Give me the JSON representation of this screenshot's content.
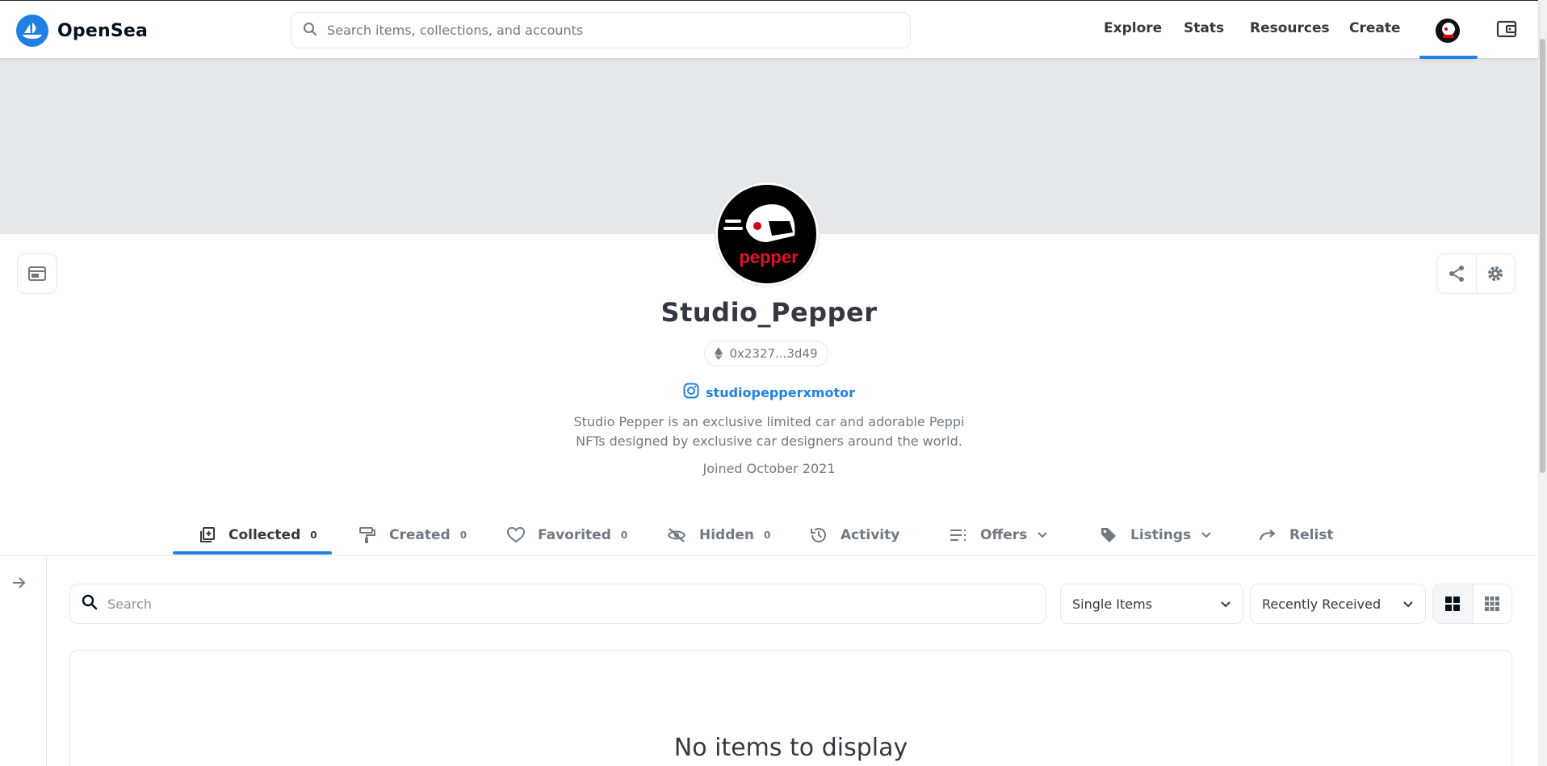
{
  "header": {
    "brand": "OpenSea",
    "search_placeholder": "Search items, collections, and accounts",
    "nav": [
      "Explore",
      "Stats",
      "Resources",
      "Create"
    ]
  },
  "profile": {
    "name": "Studio_Pepper",
    "address": "0x2327...3d49",
    "instagram": "studiopepperxmotor",
    "bio_line1": "Studio Pepper is an exclusive limited car and adorable Peppi",
    "bio_line2": "NFTs designed by exclusive car designers around the world.",
    "joined": "Joined October 2021",
    "avatar_text": "pepper"
  },
  "tabs": [
    {
      "label": "Collected",
      "count": "0",
      "icon": "collected-icon"
    },
    {
      "label": "Created",
      "count": "0",
      "icon": "paint-roller-icon"
    },
    {
      "label": "Favorited",
      "count": "0",
      "icon": "heart-icon"
    },
    {
      "label": "Hidden",
      "count": "0",
      "icon": "eye-off-icon"
    },
    {
      "label": "Activity",
      "icon": "history-icon"
    },
    {
      "label": "Offers",
      "icon": "list-icon"
    },
    {
      "label": "Listings",
      "icon": "tag-icon"
    },
    {
      "label": "Relist",
      "icon": "redo-icon"
    }
  ],
  "grid": {
    "search_placeholder": "Search",
    "type_select": "Single Items",
    "sort_select": "Recently Received",
    "empty_message": "No items to display"
  },
  "colors": {
    "accent": "#2081e2",
    "banner": "#e5e8eb",
    "text_primary": "#353840",
    "text_secondary": "#707a83"
  }
}
